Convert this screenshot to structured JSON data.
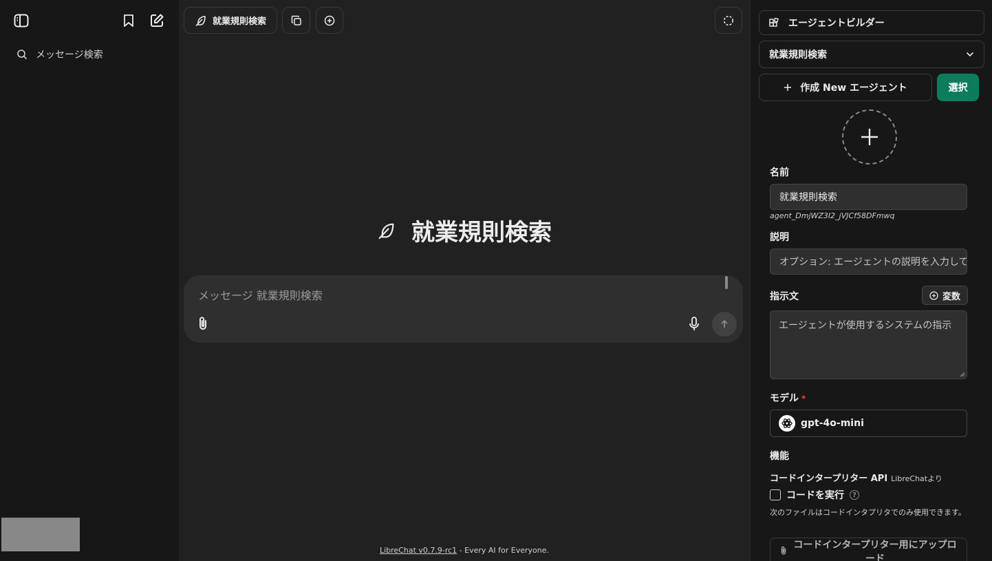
{
  "sidebar": {
    "search_label": "メッセージ検索"
  },
  "header": {
    "agent_button_label": "就業規則検索"
  },
  "main": {
    "landing_title": "就業規則検索",
    "composer_placeholder": "メッセージ 就業規則検索",
    "footer_link": "LibreChat v0.7.9-rc1",
    "footer_text": " - Every AI for Everyone."
  },
  "panel": {
    "header_title": "エージェントビルダー",
    "selected_agent": "就業規則検索",
    "create_button": "作成 New エージェント",
    "select_button": "選択",
    "name_label": "名前",
    "name_value": "就業規則検索",
    "agent_id": "agent_DmjWZ3I2_jVJCf58DFmwq",
    "description_label": "説明",
    "description_placeholder": "オプション: エージェントの説明を入力して",
    "instructions_label": "指示文",
    "variables_button": "変数",
    "instructions_placeholder": "エージェントが使用するシステムの指示",
    "model_label": "モデル",
    "model_required_mark": "*",
    "model_value": "gpt-4o-mini",
    "capabilities_label": "機能",
    "code_interpreter_title": "コードインタープリター API",
    "code_interpreter_sub": "LibreChatより",
    "run_code_label": "コードを実行",
    "help_mark": "?",
    "code_interpreter_note": "次のファイルはコードインタプリタでのみ使用できます。",
    "upload_button": "コードインタープリター用にアップロード"
  },
  "colors": {
    "accent_green": "#0c7c5c",
    "background": "#212121",
    "sidebar_bg": "#171717",
    "required_red": "#ef4444"
  }
}
